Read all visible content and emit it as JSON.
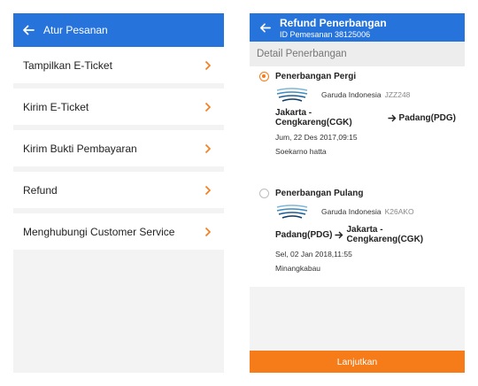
{
  "left": {
    "title": "Atur Pesanan",
    "items": [
      {
        "label": "Tampilkan E-Ticket"
      },
      {
        "label": "Kirim E-Ticket"
      },
      {
        "label": "Kirim Bukti Pembayaran"
      },
      {
        "label": "Refund"
      },
      {
        "label": "Menghubungi Customer Service"
      }
    ]
  },
  "right": {
    "title": "Refund Penerbangan",
    "subtitle": "ID Pemesanan 38125006",
    "section": "Detail Penerbangan",
    "flights": [
      {
        "label": "Penerbangan Pergi",
        "selected": true,
        "airline": "Garuda Indonesia",
        "code": "JZZ248",
        "from": "Jakarta - Cengkareng(CGK)",
        "to": "Padang(PDG)",
        "datetime": "Jum, 22 Des 2017,09:15",
        "airport": "Soekarno hatta"
      },
      {
        "label": "Penerbangan Pulang",
        "selected": false,
        "airline": "Garuda Indonesia",
        "code": "K26AKO",
        "from": "Padang(PDG)",
        "to": "Jakarta - Cengkareng(CGK)",
        "datetime": "Sel, 02 Jan 2018,11:55",
        "airport": "Minangkabau"
      }
    ],
    "cta": "Lanjutkan"
  },
  "colors": {
    "primary": "#2673dc",
    "accent": "#f57c18",
    "background": "#f3f3f3"
  },
  "icons": {
    "back": "arrow-left-icon",
    "chevron": "chevron-right-icon",
    "airline_logo": "garuda-logo-icon"
  }
}
